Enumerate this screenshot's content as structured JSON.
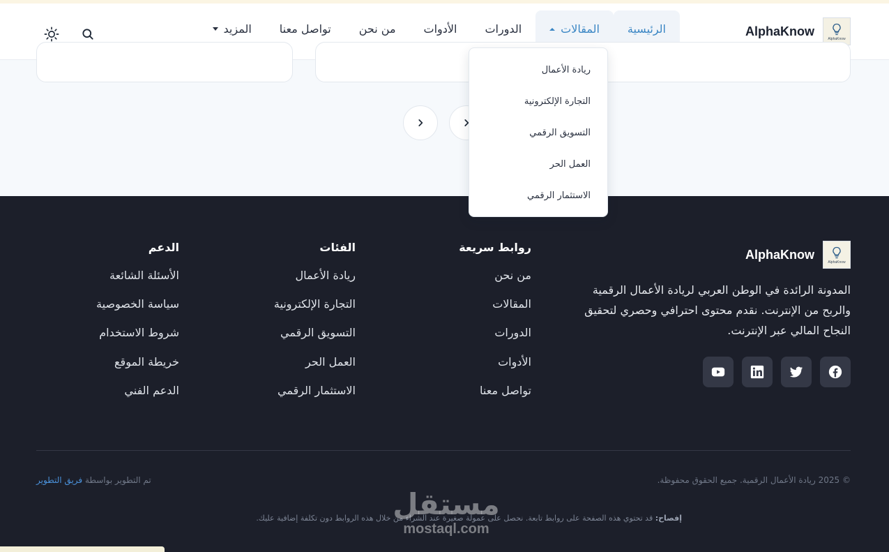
{
  "brand": {
    "name": "AlphaKnow",
    "logo_caption": "AlphaKnow"
  },
  "nav": {
    "items": [
      {
        "label": "الرئيسية"
      },
      {
        "label": "المقالات"
      },
      {
        "label": "الدورات"
      },
      {
        "label": "الأدوات"
      },
      {
        "label": "من نحن"
      },
      {
        "label": "تواصل معنا"
      },
      {
        "label": "المزيد"
      }
    ],
    "active": "الرئيسية",
    "open_menu": "المقالات"
  },
  "dropdown": {
    "items": [
      "ريادة الأعمال",
      "التجارة الإلكترونية",
      "التسويق الرقمي",
      "العمل الحر",
      "الاستثمار الرقمي"
    ]
  },
  "icons": {
    "search": "search-icon",
    "theme": "sun-icon",
    "pagination": [
      "chevron-right-icon",
      "chevron-left-icon"
    ],
    "social": [
      "facebook-icon",
      "twitter-icon",
      "linkedin-icon",
      "youtube-icon"
    ]
  },
  "footer": {
    "description": "المدونة الرائدة في الوطن العربي لريادة الأعمال الرقمية والربح من الإنترنت. نقدم محتوى احترافي وحصري لتحقيق النجاح المالي عبر الإنترنت.",
    "quick_links": {
      "title": "روابط سريعة",
      "items": [
        "من نحن",
        "المقالات",
        "الدورات",
        "الأدوات",
        "تواصل معنا"
      ]
    },
    "categories": {
      "title": "الفئات",
      "items": [
        "ريادة الأعمال",
        "التجارة الإلكترونية",
        "التسويق الرقمي",
        "العمل الحر",
        "الاستثمار الرقمي"
      ]
    },
    "support": {
      "title": "الدعم",
      "items": [
        "الأسئلة الشائعة",
        "سياسة الخصوصية",
        "شروط الاستخدام",
        "خريطة الموقع",
        "الدعم الفني"
      ]
    },
    "copyright": "© 2025 ريادة الأعمال الرقمية. جميع الحقوق محفوظة.",
    "developed_by_prefix": "تم التطوير بواسطة",
    "developed_by_link": "فريق التطوير",
    "disclosure_label": "إفصاح:",
    "disclosure_text": "قد تحتوي هذه الصفحة على روابط تابعة. نحصل على عمولة صغيرة عند الشراء من خلال هذه الروابط دون تكلفة إضافية عليك."
  },
  "watermark": {
    "arabic": "مستقل",
    "latin": "mostaql.com"
  },
  "colors": {
    "accent": "#3a86c4",
    "footer_bg": "#1c1f2a",
    "page_bg": "#f6f9fc",
    "link": "#4a90d9"
  }
}
